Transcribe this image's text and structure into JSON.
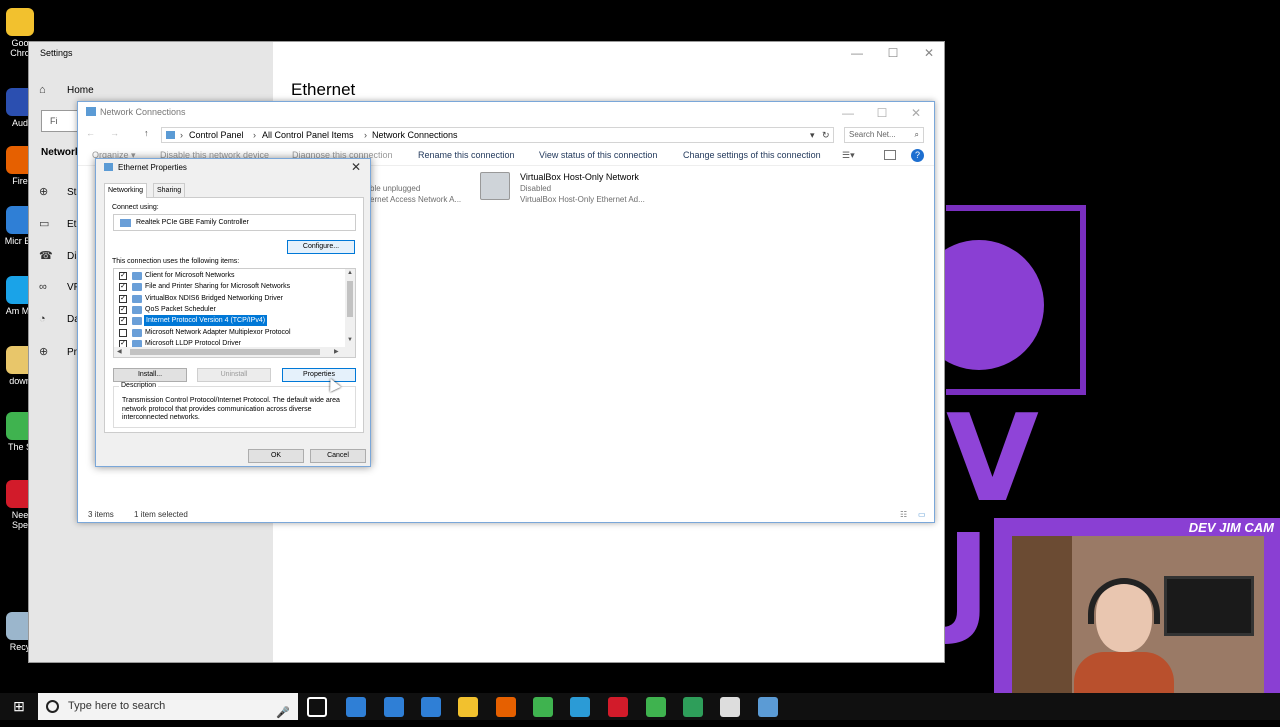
{
  "desktop": {
    "icons": [
      {
        "name": "chrome",
        "label": "Goo Chro",
        "color": "#f2c12e"
      },
      {
        "name": "audacity",
        "label": "Aud",
        "color": "#2b4fb0"
      },
      {
        "name": "firefox",
        "label": "Fire",
        "color": "#e66000"
      },
      {
        "name": "edge",
        "label": "Micr Ed",
        "color": "#2f7fd6"
      },
      {
        "name": "amazon-music",
        "label": "Am Mu",
        "color": "#1aa3e8"
      },
      {
        "name": "downloads",
        "label": "down",
        "color": "#e8c66a"
      },
      {
        "name": "sims",
        "label": "The S",
        "color": "#3fb34f"
      },
      {
        "name": "nfs",
        "label": "Nee Spe",
        "color": "#d21b2a"
      },
      {
        "name": "recycle-bin",
        "label": "Recy",
        "color": "#9bb6cc"
      }
    ]
  },
  "branding": {
    "big_text": "V JIM",
    "cam_label": "DEV JIM CAM"
  },
  "settings": {
    "title": "Settings",
    "heading": "Ethernet",
    "find_placeholder": "Fi",
    "nav": [
      {
        "icon": "home-icon",
        "glyph": "⌂",
        "label": "Home"
      },
      {
        "icon": "none",
        "glyph": "",
        "label": "Network"
      },
      {
        "icon": "status-icon",
        "glyph": "⊕",
        "label": "Sta"
      },
      {
        "icon": "ethernet-icon",
        "glyph": "▭",
        "label": "Eth"
      },
      {
        "icon": "dialup-icon",
        "glyph": "☎",
        "label": "Dia"
      },
      {
        "icon": "vpn-icon",
        "glyph": "∞",
        "label": "VP"
      },
      {
        "icon": "data-usage-icon",
        "glyph": "◔",
        "label": "Da"
      },
      {
        "icon": "proxy-icon",
        "glyph": "⊕",
        "label": "Pro"
      }
    ]
  },
  "netcon": {
    "title": "Network Connections",
    "breadcrumb": [
      "Control Panel",
      "All Control Panel Items",
      "Network Connections"
    ],
    "search_placeholder": "Search Net...",
    "commands": [
      "Organize ▾",
      "Disable this network device",
      "Diagnose this connection",
      "Rename this connection",
      "View status of this connection",
      "Change settings of this connection"
    ],
    "connections": [
      {
        "name": "",
        "line1": "ble unplugged",
        "line2": "ernet Access Network A..."
      },
      {
        "name": "VirtualBox Host-Only Network",
        "line1": "Disabled",
        "line2": "VirtualBox Host-Only Ethernet Ad..."
      }
    ],
    "status": {
      "items": "3 items",
      "selected": "1 item selected"
    }
  },
  "dialog": {
    "title": "Ethernet Properties",
    "tabs": [
      "Networking",
      "Sharing"
    ],
    "connect_using_label": "Connect using:",
    "adapter": "Realtek PCIe GBE Family Controller",
    "configure": "Configure...",
    "items_label": "This connection uses the following items:",
    "items": [
      {
        "checked": true,
        "label": "Client for Microsoft Networks",
        "selected": false
      },
      {
        "checked": true,
        "label": "File and Printer Sharing for Microsoft Networks",
        "selected": false
      },
      {
        "checked": true,
        "label": "VirtualBox NDIS6 Bridged Networking Driver",
        "selected": false
      },
      {
        "checked": true,
        "label": "QoS Packet Scheduler",
        "selected": false
      },
      {
        "checked": true,
        "label": "Internet Protocol Version 4 (TCP/IPv4)",
        "selected": true
      },
      {
        "checked": false,
        "label": "Microsoft Network Adapter Multiplexor Protocol",
        "selected": false
      },
      {
        "checked": true,
        "label": "Microsoft LLDP Protocol Driver",
        "selected": false
      }
    ],
    "install": "Install...",
    "uninstall": "Uninstall",
    "properties": "Properties",
    "description_label": "Description",
    "description": "Transmission Control Protocol/Internet Protocol. The default wide area network protocol that provides communication across diverse interconnected networks.",
    "ok": "OK",
    "cancel": "Cancel"
  },
  "taskbar": {
    "search_placeholder": "Type here to search",
    "apps": [
      {
        "name": "task-view",
        "color": "#ffffff"
      },
      {
        "name": "edge",
        "color": "#2f7fd6"
      },
      {
        "name": "store",
        "color": "#2f7fd6"
      },
      {
        "name": "mail",
        "color": "#2f7fd6"
      },
      {
        "name": "file-explorer",
        "color": "#f2c12e"
      },
      {
        "name": "firefox",
        "color": "#e66000"
      },
      {
        "name": "chrome",
        "color": "#3fb34f"
      },
      {
        "name": "app-blue",
        "color": "#2b9bd6"
      },
      {
        "name": "app-red",
        "color": "#d21b2a"
      },
      {
        "name": "camtasia",
        "color": "#3fb34f"
      },
      {
        "name": "app-green",
        "color": "#2e9e5a"
      },
      {
        "name": "settings",
        "color": "#dddddd"
      },
      {
        "name": "network-connections",
        "color": "#5b9bd5"
      }
    ]
  }
}
